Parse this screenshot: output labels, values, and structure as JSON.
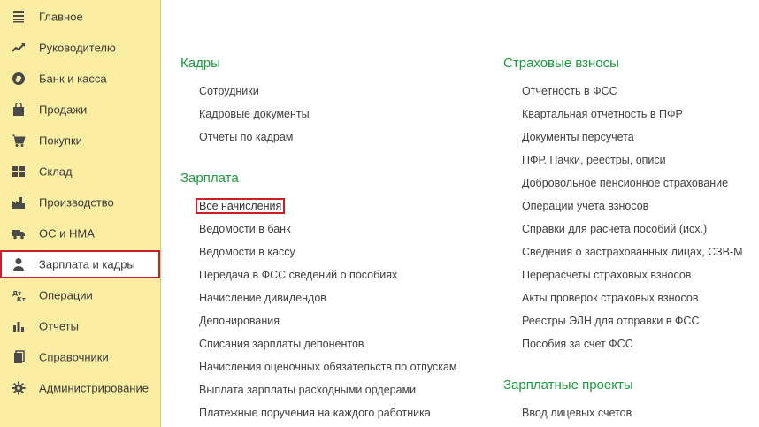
{
  "sidebar": {
    "items": [
      {
        "label": "Главное",
        "icon": "menu-lines-icon"
      },
      {
        "label": "Руководителю",
        "icon": "trend-icon"
      },
      {
        "label": "Банк и касса",
        "icon": "ruble-coin-icon"
      },
      {
        "label": "Продажи",
        "icon": "shopping-bag-icon"
      },
      {
        "label": "Покупки",
        "icon": "cart-icon"
      },
      {
        "label": "Склад",
        "icon": "warehouse-grid-icon"
      },
      {
        "label": "Производство",
        "icon": "factory-icon"
      },
      {
        "label": "ОС и НМА",
        "icon": "truck-icon"
      },
      {
        "label": "Зарплата и кадры",
        "icon": "person-icon",
        "selected": true
      },
      {
        "label": "Операции",
        "icon": "dt-kt-icon"
      },
      {
        "label": "Отчеты",
        "icon": "bar-chart-icon"
      },
      {
        "label": "Справочники",
        "icon": "books-icon"
      },
      {
        "label": "Администрирование",
        "icon": "gear-icon"
      }
    ]
  },
  "left_column": {
    "kadry": {
      "title": "Кадры",
      "links": [
        "Сотрудники",
        "Кадровые документы",
        "Отчеты по кадрам"
      ]
    },
    "zarplata": {
      "title": "Зарплата",
      "links": [
        "Все начисления",
        "Ведомости в банк",
        "Ведомости в кассу",
        "Передача в ФСС сведений о пособиях",
        "Начисление дивидендов",
        "Депонирования",
        "Списания зарплаты депонентов",
        "Начисления оценочных обязательств по отпускам",
        "Выплата зарплаты расходными ордерами",
        "Платежные поручения на каждого работника"
      ]
    }
  },
  "right_column": {
    "vznosy": {
      "title": "Страховые взносы",
      "links": [
        "Отчетность в ФСС",
        "Квартальная отчетность в ПФР",
        "Документы персучета",
        "ПФР. Пачки, реестры, описи",
        "Добровольное пенсионное страхование",
        "Операции учета взносов",
        "Справки для расчета пособий (исх.)",
        "Сведения о застрахованных лицах, СЗВ-М",
        "Перерасчеты страховых взносов",
        "Акты проверок страховых взносов",
        "Реестры ЭЛН для отправки в ФСС",
        "Пособия за счет ФСС"
      ]
    },
    "proekty": {
      "title": "Зарплатные проекты",
      "links": [
        "Ввод лицевых счетов"
      ]
    }
  },
  "colors": {
    "sidebar_bg": "#fbeda2",
    "section_title": "#1a9a3c",
    "highlight_border": "#cc1f2a",
    "icon": "#4a4a4a"
  }
}
